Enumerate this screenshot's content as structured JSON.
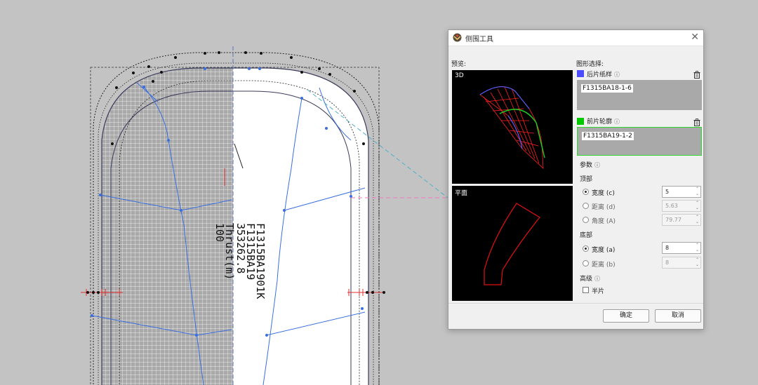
{
  "canvas": {
    "overlay_text_lines": [
      "F1315BA1901K",
      "F1315BA19",
      "353262.8",
      "Thrust(m)",
      "100"
    ],
    "colors": {
      "mesh": "#ffffff",
      "pattern_line": "#3a6fe0",
      "outline": "#3b3b5b",
      "handle": "#e03030"
    }
  },
  "dialog": {
    "title": "侧围工具",
    "app_icon": "pattern-app-icon",
    "preview_label": "预览:",
    "preview_3d_tag": "3D",
    "preview_plane_tag": "平面",
    "shape_select_label": "图形选择:",
    "back_piece": {
      "label": "后片纸样",
      "value": "F1315BA18-1-6",
      "swatch_color": "#4b4bff"
    },
    "front_piece": {
      "label": "前片轮廓",
      "value": "F1315BA19-1-2",
      "swatch_color": "#00c800"
    },
    "params_label": "参数",
    "top_section_label": "顶部",
    "top": {
      "width_label": "宽度 (c)",
      "width_value": "5",
      "distance_label": "距离 (d)",
      "distance_value": "5.63",
      "angle_label": "角度 (A)",
      "angle_value": "79.77",
      "selected": "width"
    },
    "bottom_section_label": "底部",
    "bottom": {
      "width_label": "宽度 (a)",
      "width_value": "8",
      "distance_label": "距离 (b)",
      "distance_value": "8",
      "selected": "width"
    },
    "advanced_label": "高级",
    "half_piece_label": "半片",
    "half_piece_checked": false,
    "ok_label": "确定",
    "cancel_label": "取消"
  }
}
